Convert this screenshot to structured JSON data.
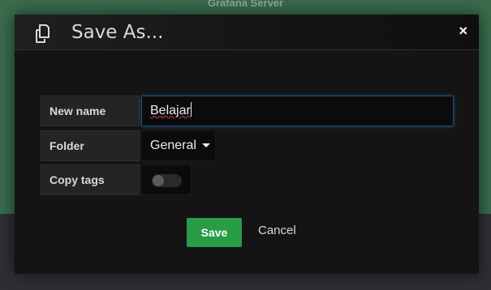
{
  "background": {
    "page_title": "Grafana Server",
    "colors": {
      "top": "#3a6b4c",
      "bottom": "#2d2f33"
    }
  },
  "modal": {
    "title": "Save As...",
    "icon": "copy-icon",
    "close_icon": "close-icon",
    "close_label": "×"
  },
  "form": {
    "name": {
      "label": "New name",
      "value": "Belajar"
    },
    "folder": {
      "label": "Folder",
      "value": "General"
    },
    "copy_tags": {
      "label": "Copy tags",
      "enabled": false
    }
  },
  "actions": {
    "save_label": "Save",
    "cancel_label": "Cancel"
  },
  "colors": {
    "accent_green": "#299c46",
    "input_focus": "#1f4a86"
  }
}
